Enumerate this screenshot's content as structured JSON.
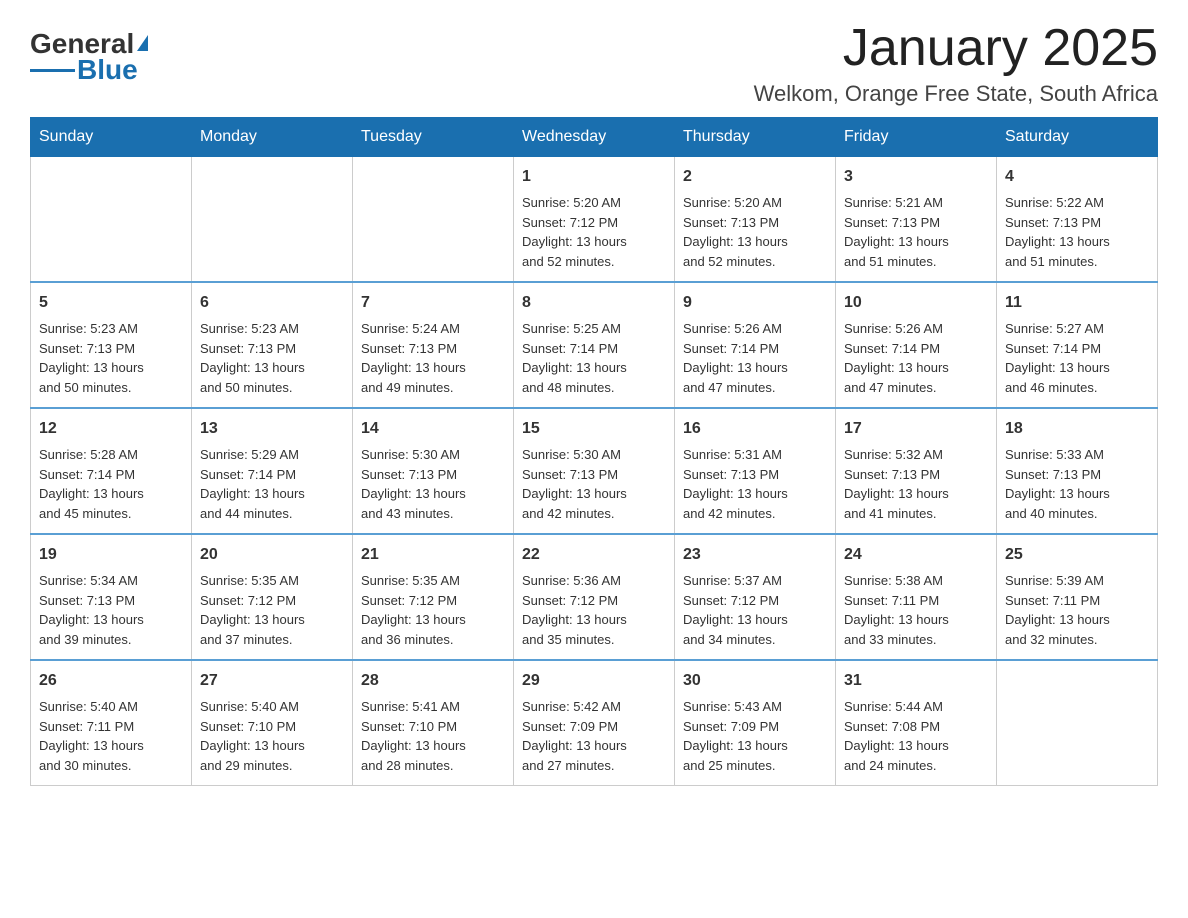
{
  "logo": {
    "text_general": "General",
    "text_blue": "Blue"
  },
  "header": {
    "month_year": "January 2025",
    "location": "Welkom, Orange Free State, South Africa"
  },
  "days_of_week": [
    "Sunday",
    "Monday",
    "Tuesday",
    "Wednesday",
    "Thursday",
    "Friday",
    "Saturday"
  ],
  "weeks": [
    [
      {
        "day": "",
        "info": ""
      },
      {
        "day": "",
        "info": ""
      },
      {
        "day": "",
        "info": ""
      },
      {
        "day": "1",
        "info": "Sunrise: 5:20 AM\nSunset: 7:12 PM\nDaylight: 13 hours\nand 52 minutes."
      },
      {
        "day": "2",
        "info": "Sunrise: 5:20 AM\nSunset: 7:13 PM\nDaylight: 13 hours\nand 52 minutes."
      },
      {
        "day": "3",
        "info": "Sunrise: 5:21 AM\nSunset: 7:13 PM\nDaylight: 13 hours\nand 51 minutes."
      },
      {
        "day": "4",
        "info": "Sunrise: 5:22 AM\nSunset: 7:13 PM\nDaylight: 13 hours\nand 51 minutes."
      }
    ],
    [
      {
        "day": "5",
        "info": "Sunrise: 5:23 AM\nSunset: 7:13 PM\nDaylight: 13 hours\nand 50 minutes."
      },
      {
        "day": "6",
        "info": "Sunrise: 5:23 AM\nSunset: 7:13 PM\nDaylight: 13 hours\nand 50 minutes."
      },
      {
        "day": "7",
        "info": "Sunrise: 5:24 AM\nSunset: 7:13 PM\nDaylight: 13 hours\nand 49 minutes."
      },
      {
        "day": "8",
        "info": "Sunrise: 5:25 AM\nSunset: 7:14 PM\nDaylight: 13 hours\nand 48 minutes."
      },
      {
        "day": "9",
        "info": "Sunrise: 5:26 AM\nSunset: 7:14 PM\nDaylight: 13 hours\nand 47 minutes."
      },
      {
        "day": "10",
        "info": "Sunrise: 5:26 AM\nSunset: 7:14 PM\nDaylight: 13 hours\nand 47 minutes."
      },
      {
        "day": "11",
        "info": "Sunrise: 5:27 AM\nSunset: 7:14 PM\nDaylight: 13 hours\nand 46 minutes."
      }
    ],
    [
      {
        "day": "12",
        "info": "Sunrise: 5:28 AM\nSunset: 7:14 PM\nDaylight: 13 hours\nand 45 minutes."
      },
      {
        "day": "13",
        "info": "Sunrise: 5:29 AM\nSunset: 7:14 PM\nDaylight: 13 hours\nand 44 minutes."
      },
      {
        "day": "14",
        "info": "Sunrise: 5:30 AM\nSunset: 7:13 PM\nDaylight: 13 hours\nand 43 minutes."
      },
      {
        "day": "15",
        "info": "Sunrise: 5:30 AM\nSunset: 7:13 PM\nDaylight: 13 hours\nand 42 minutes."
      },
      {
        "day": "16",
        "info": "Sunrise: 5:31 AM\nSunset: 7:13 PM\nDaylight: 13 hours\nand 42 minutes."
      },
      {
        "day": "17",
        "info": "Sunrise: 5:32 AM\nSunset: 7:13 PM\nDaylight: 13 hours\nand 41 minutes."
      },
      {
        "day": "18",
        "info": "Sunrise: 5:33 AM\nSunset: 7:13 PM\nDaylight: 13 hours\nand 40 minutes."
      }
    ],
    [
      {
        "day": "19",
        "info": "Sunrise: 5:34 AM\nSunset: 7:13 PM\nDaylight: 13 hours\nand 39 minutes."
      },
      {
        "day": "20",
        "info": "Sunrise: 5:35 AM\nSunset: 7:12 PM\nDaylight: 13 hours\nand 37 minutes."
      },
      {
        "day": "21",
        "info": "Sunrise: 5:35 AM\nSunset: 7:12 PM\nDaylight: 13 hours\nand 36 minutes."
      },
      {
        "day": "22",
        "info": "Sunrise: 5:36 AM\nSunset: 7:12 PM\nDaylight: 13 hours\nand 35 minutes."
      },
      {
        "day": "23",
        "info": "Sunrise: 5:37 AM\nSunset: 7:12 PM\nDaylight: 13 hours\nand 34 minutes."
      },
      {
        "day": "24",
        "info": "Sunrise: 5:38 AM\nSunset: 7:11 PM\nDaylight: 13 hours\nand 33 minutes."
      },
      {
        "day": "25",
        "info": "Sunrise: 5:39 AM\nSunset: 7:11 PM\nDaylight: 13 hours\nand 32 minutes."
      }
    ],
    [
      {
        "day": "26",
        "info": "Sunrise: 5:40 AM\nSunset: 7:11 PM\nDaylight: 13 hours\nand 30 minutes."
      },
      {
        "day": "27",
        "info": "Sunrise: 5:40 AM\nSunset: 7:10 PM\nDaylight: 13 hours\nand 29 minutes."
      },
      {
        "day": "28",
        "info": "Sunrise: 5:41 AM\nSunset: 7:10 PM\nDaylight: 13 hours\nand 28 minutes."
      },
      {
        "day": "29",
        "info": "Sunrise: 5:42 AM\nSunset: 7:09 PM\nDaylight: 13 hours\nand 27 minutes."
      },
      {
        "day": "30",
        "info": "Sunrise: 5:43 AM\nSunset: 7:09 PM\nDaylight: 13 hours\nand 25 minutes."
      },
      {
        "day": "31",
        "info": "Sunrise: 5:44 AM\nSunset: 7:08 PM\nDaylight: 13 hours\nand 24 minutes."
      },
      {
        "day": "",
        "info": ""
      }
    ]
  ]
}
